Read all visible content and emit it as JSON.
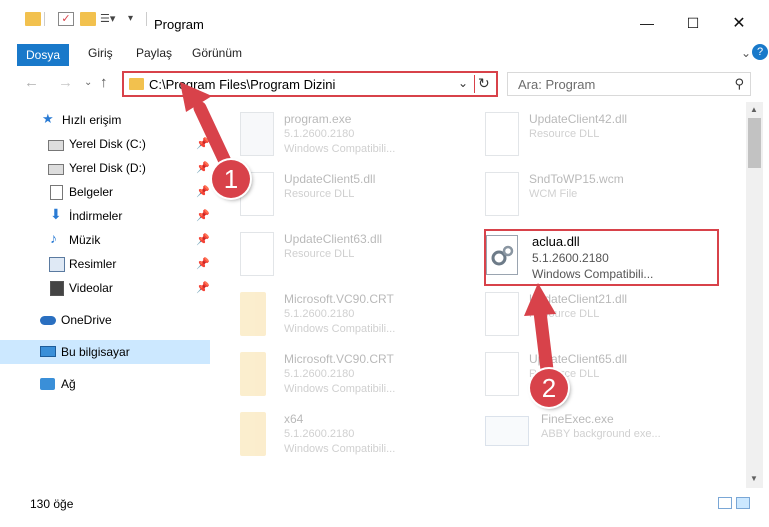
{
  "window": {
    "title": "Program",
    "minimize_icon": "minimize-icon",
    "maximize_icon": "maximize-icon",
    "close_icon": "close-icon"
  },
  "ribbon": {
    "tabs": [
      "Dosya",
      "Giriş",
      "Paylaş",
      "Görünüm"
    ],
    "help": "?"
  },
  "navigation": {
    "address": "C:\\Program Files\\Program Dizini",
    "search_placeholder": "Ara: Program"
  },
  "sidebar": {
    "items": [
      {
        "label": "Hızlı erişim",
        "icon": "star-icon",
        "pinned": false
      },
      {
        "label": "Yerel Disk (C:)",
        "icon": "drive-icon",
        "pinned": true
      },
      {
        "label": "Yerel Disk (D:)",
        "icon": "drive-icon",
        "pinned": true
      },
      {
        "label": "Belgeler",
        "icon": "documents-icon",
        "pinned": true
      },
      {
        "label": "İndirmeler",
        "icon": "download-icon",
        "pinned": true
      },
      {
        "label": "Müzik",
        "icon": "music-icon",
        "pinned": true
      },
      {
        "label": "Resimler",
        "icon": "pictures-icon",
        "pinned": true
      },
      {
        "label": "Videolar",
        "icon": "videos-icon",
        "pinned": true
      },
      {
        "label": "OneDrive",
        "icon": "cloud-icon",
        "pinned": false
      },
      {
        "label": "Bu bilgisayar",
        "icon": "computer-icon",
        "pinned": false,
        "selected": true
      },
      {
        "label": "Ağ",
        "icon": "network-icon",
        "pinned": false
      }
    ]
  },
  "files": [
    {
      "name": "program.exe",
      "line1": "5.1.2600.2180",
      "line2": "Windows Compatibili...",
      "icon": "exe-icon"
    },
    {
      "name": "UpdateClient42.dll",
      "line1": "Resource DLL",
      "line2": "",
      "icon": "dll-icon"
    },
    {
      "name": "UpdateClient5.dll",
      "line1": "Resource DLL",
      "line2": "",
      "icon": "dll-icon"
    },
    {
      "name": "SndToWP15.wcm",
      "line1": "WCM File",
      "line2": "",
      "icon": "file-icon"
    },
    {
      "name": "UpdateClient63.dll",
      "line1": "Resource DLL",
      "line2": "",
      "icon": "dll-icon"
    },
    {
      "name": "aclua.dll",
      "line1": "5.1.2600.2180",
      "line2": "Windows Compatibili...",
      "icon": "gear-dll-icon",
      "highlighted": true
    },
    {
      "name": "Microsoft.VC90.CRT",
      "line1": "5.1.2600.2180",
      "line2": "Windows Compatibili...",
      "icon": "folder-icon"
    },
    {
      "name": "UpdateClient21.dll",
      "line1": "Resource DLL",
      "line2": "",
      "icon": "dll-icon"
    },
    {
      "name": "Microsoft.VC90.CRT",
      "line1": "5.1.2600.2180",
      "line2": "Windows Compatibili...",
      "icon": "folder-icon"
    },
    {
      "name": "UpdateClient65.dll",
      "line1": "Resource DLL",
      "line2": "",
      "icon": "dll-icon"
    },
    {
      "name": "x64",
      "line1": "5.1.2600.2180",
      "line2": "Windows Compatibili...",
      "icon": "folder-icon"
    },
    {
      "name": "FineExec.exe",
      "line1": "ABBY background exe...",
      "line2": "",
      "icon": "app-icon"
    }
  ],
  "callouts": [
    "1",
    "2"
  ],
  "status": {
    "count": "130 öğe"
  },
  "colors": {
    "accent": "#1979ca",
    "highlight_red": "#d8424a",
    "selected_bg": "#cce8ff",
    "folder": "#f2c14e"
  }
}
